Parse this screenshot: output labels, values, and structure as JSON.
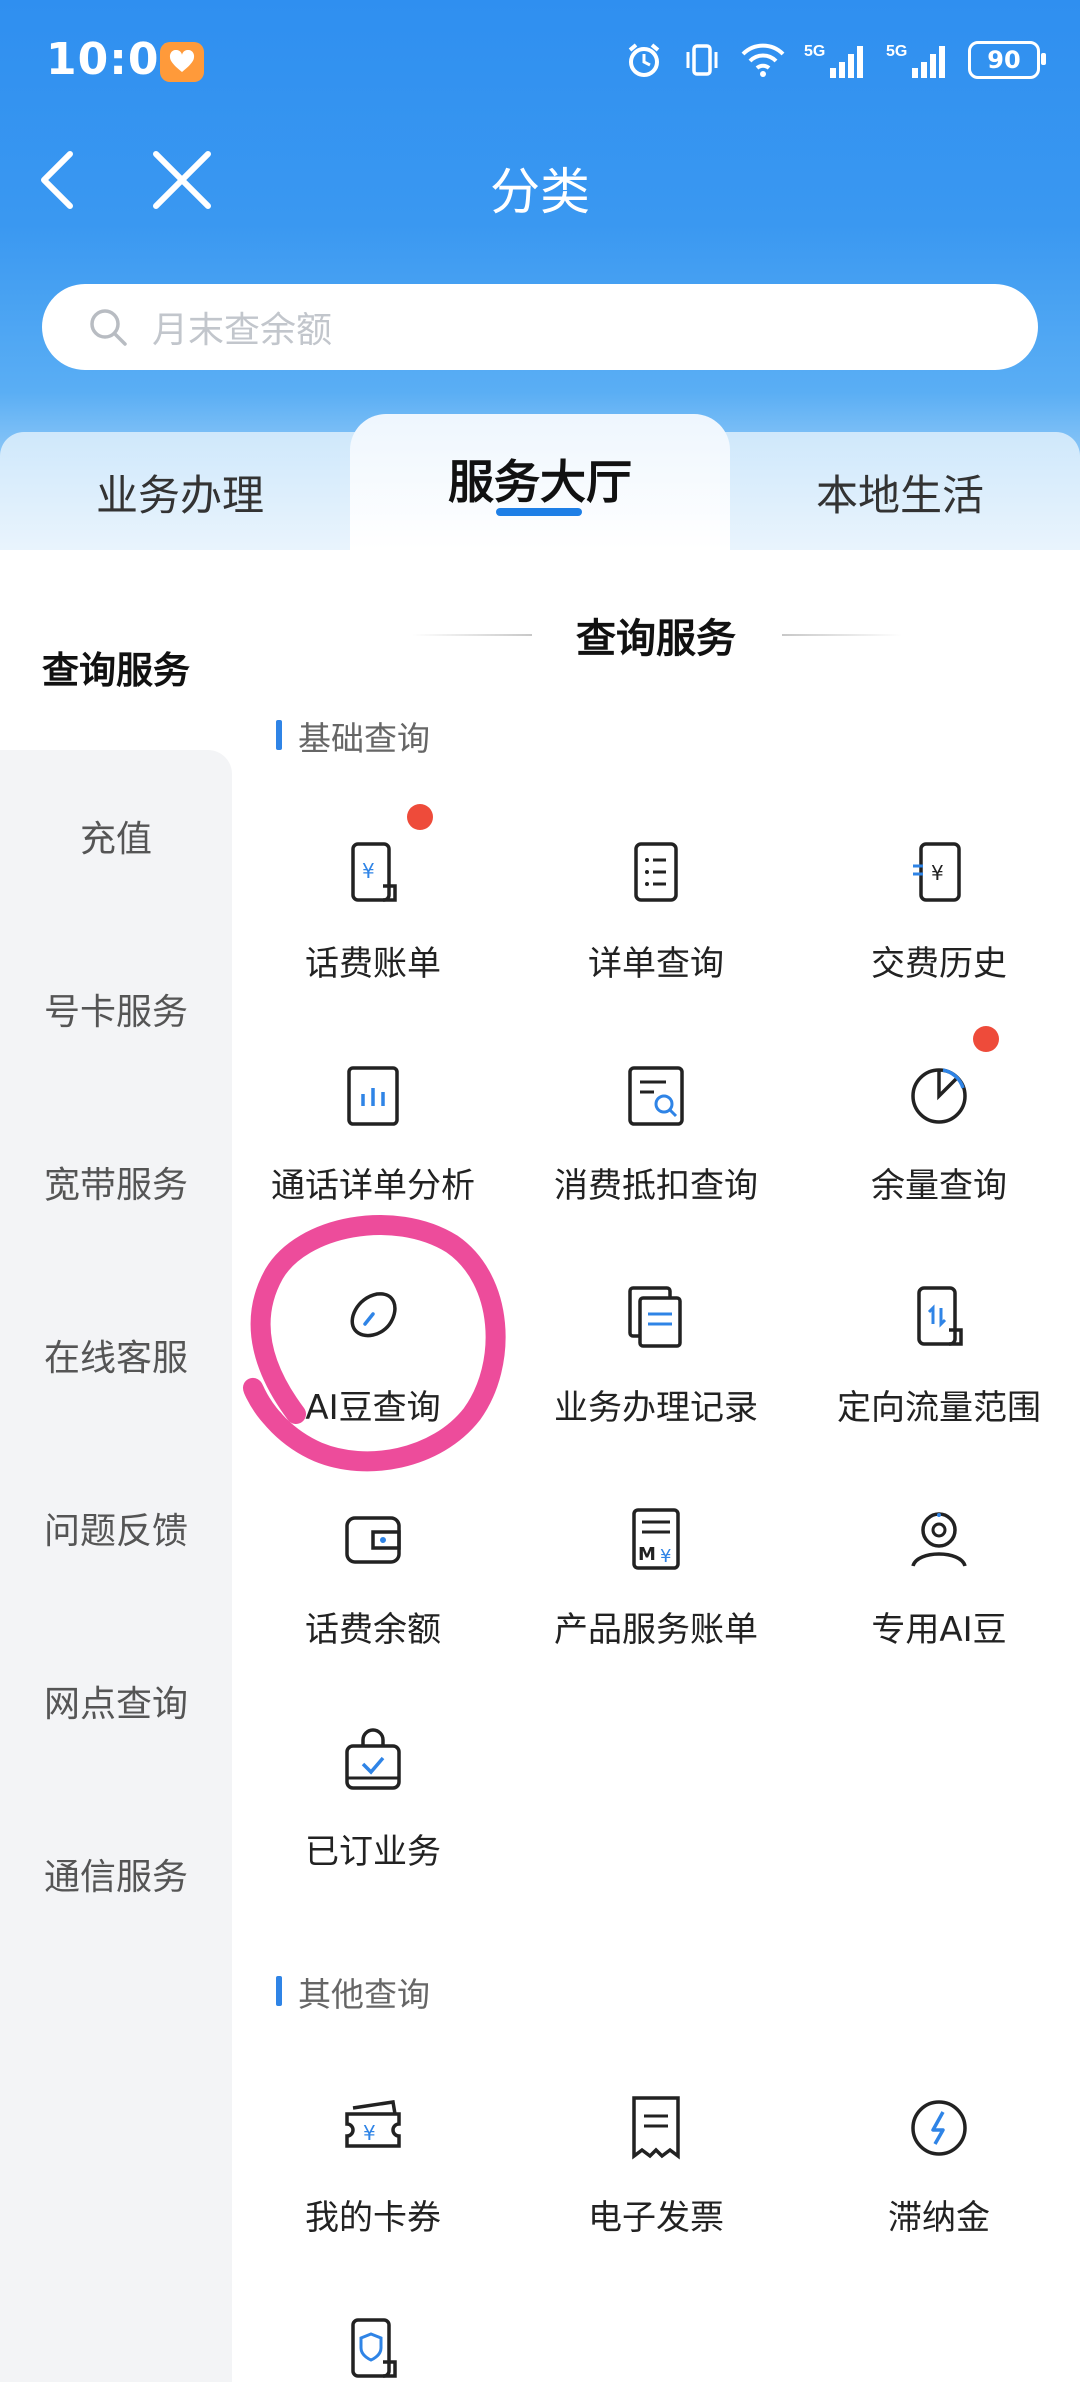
{
  "status_bar": {
    "time": "10:01",
    "battery": "90",
    "network": "5G"
  },
  "nav": {
    "title": "分类"
  },
  "search": {
    "placeholder": "月末查余额"
  },
  "tabs": [
    "业务办理",
    "服务大厅",
    "本地生活"
  ],
  "active_tab": "服务大厅",
  "sidebar": {
    "items": [
      "查询服务",
      "充值",
      "号卡服务",
      "宽带服务",
      "在线客服",
      "问题反馈",
      "网点查询",
      "通信服务"
    ],
    "active": "查询服务"
  },
  "main": {
    "section_title": "查询服务",
    "groups": [
      {
        "label": "基础查询",
        "items": [
          {
            "label": "话费账单",
            "icon": "phone-bill-icon",
            "badge": true
          },
          {
            "label": "详单查询",
            "icon": "list-doc-icon"
          },
          {
            "label": "交费历史",
            "icon": "payment-history-icon"
          },
          {
            "label": "通话详单分析",
            "icon": "bar-chart-icon"
          },
          {
            "label": "消费抵扣查询",
            "icon": "search-doc-icon"
          },
          {
            "label": "余量查询",
            "icon": "pie-chart-icon",
            "badge": true
          },
          {
            "label": "AI豆查询",
            "icon": "bean-icon"
          },
          {
            "label": "业务办理记录",
            "icon": "records-icon"
          },
          {
            "label": "定向流量范围",
            "icon": "data-transfer-icon"
          },
          {
            "label": "话费余额",
            "icon": "wallet-icon"
          },
          {
            "label": "产品服务账单",
            "icon": "product-bill-icon"
          },
          {
            "label": "专用AI豆",
            "icon": "user-badge-icon"
          },
          {
            "label": "已订业务",
            "icon": "subscribed-bag-icon"
          }
        ]
      },
      {
        "label": "其他查询",
        "items": [
          {
            "label": "我的卡券",
            "icon": "coupon-icon"
          },
          {
            "label": "电子发票",
            "icon": "invoice-icon"
          },
          {
            "label": "滞纳金",
            "icon": "lightning-icon"
          },
          {
            "label": "",
            "icon": "shield-doc-icon"
          }
        ]
      }
    ]
  },
  "colors": {
    "accent": "#1e7fe6",
    "header": "#3a98f1",
    "badge": "#ee4b3a",
    "annotation": "#ec3d93"
  }
}
